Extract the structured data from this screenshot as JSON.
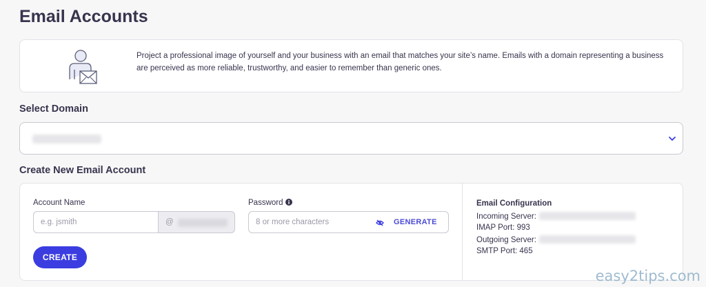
{
  "page": {
    "title": "Email Accounts"
  },
  "intro": {
    "text": "Project a professional image of yourself and your business with an email that matches your site’s name. Emails with a domain representing a business are perceived as more reliable, trustworthy, and easier to remember than generic ones.",
    "illustration_icon": "user-email-icon"
  },
  "select_domain": {
    "title": "Select Domain",
    "chevron_icon": "chevron-down-icon"
  },
  "create_account": {
    "title": "Create New Email Account",
    "account_name_label": "Account Name",
    "account_name_placeholder": "e.g. jsmith",
    "account_name_value": "",
    "domain_suffix": "@",
    "password_label": "Password",
    "password_placeholder": "8 or more characters",
    "password_value": "",
    "generate_label": "GENERATE",
    "create_label": "CREATE"
  },
  "email_config": {
    "title": "Email Configuration",
    "incoming_server_label": "Incoming Server:",
    "imap_port": "IMAP Port: 993",
    "outgoing_server_label": "Outgoing Server:",
    "smtp_port": "SMTP Port: 465"
  },
  "watermark": "easy2tips.com",
  "colors": {
    "accent": "#3b3de0",
    "title_text": "#36344d",
    "background": "#f7f7f7"
  }
}
